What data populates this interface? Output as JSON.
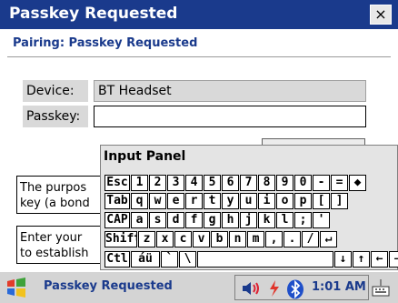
{
  "window": {
    "title": "Passkey Requested",
    "close_label": "×"
  },
  "dialog": {
    "subtitle": "Pairing: Passkey Requested",
    "device_label": "Device:",
    "device_value": "BT Headset",
    "passkey_label": "Passkey:",
    "passkey_value": ""
  },
  "info": {
    "purpose_line1": "The purpos",
    "purpose_line2": "key (a bond",
    "enter_line1": "Enter your",
    "enter_line2": "to establish"
  },
  "input_panel": {
    "title": "Input Panel",
    "rows": [
      [
        "Esc",
        "1",
        "2",
        "3",
        "4",
        "5",
        "6",
        "7",
        "8",
        "9",
        "0",
        "-",
        "=",
        "◆"
      ],
      [
        "Tab",
        "q",
        "w",
        "e",
        "r",
        "t",
        "y",
        "u",
        "i",
        "o",
        "p",
        "[",
        "]"
      ],
      [
        "CAP",
        "a",
        "s",
        "d",
        "f",
        "g",
        "h",
        "j",
        "k",
        "l",
        ";",
        "'"
      ],
      [
        "Shift",
        "z",
        "x",
        "c",
        "v",
        "b",
        "n",
        "m",
        ",",
        ".",
        "/",
        "↵"
      ],
      [
        "Ctl",
        "áü",
        "`",
        "\\",
        " ",
        "↓",
        "↑",
        "←",
        "→"
      ]
    ]
  },
  "taskbar": {
    "active_task": "Passkey Requested",
    "clock": "1:01 AM",
    "icons": [
      "start-icon",
      "speaker-icon",
      "bluetooth-icon",
      "keyboard-icon"
    ]
  },
  "colors": {
    "titlebar": "#1a3a8c",
    "accent_text": "#1a3a8c",
    "panel": "#e4e4e4"
  }
}
